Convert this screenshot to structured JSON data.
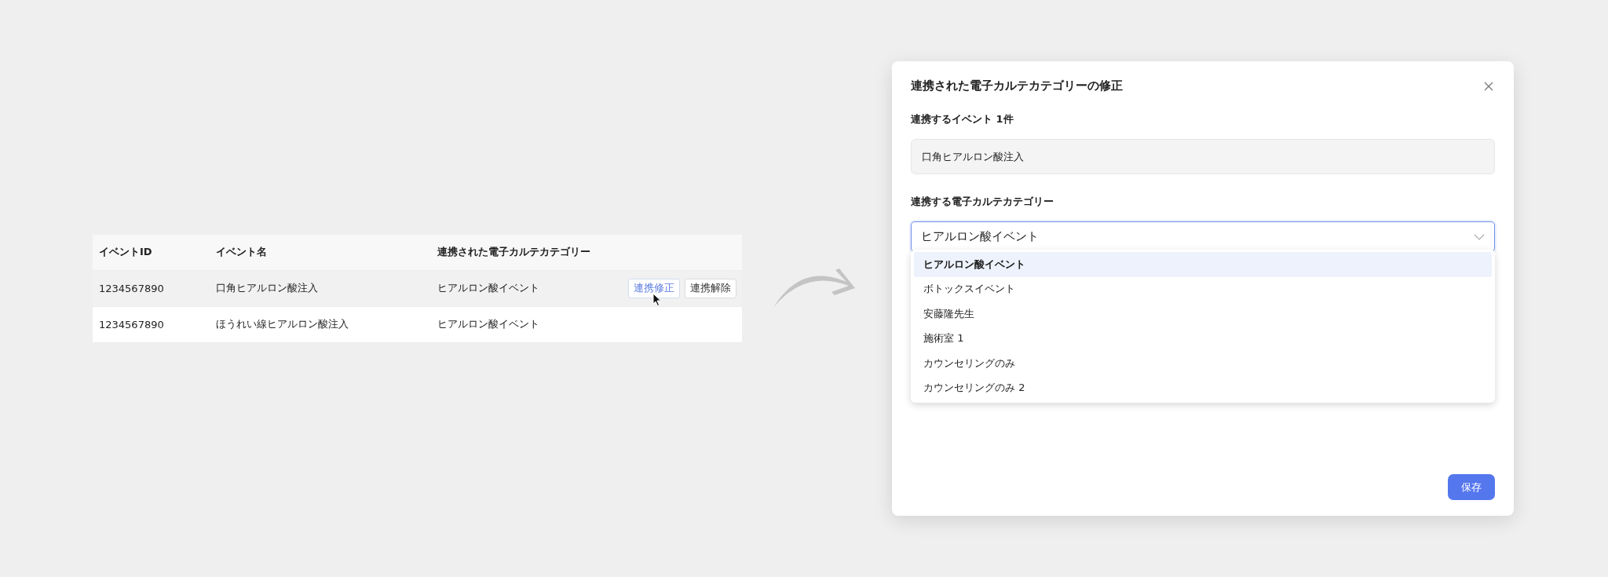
{
  "table": {
    "columns": [
      "イベントID",
      "イベント名",
      "連携された電子カルテカテゴリー"
    ],
    "rows": [
      {
        "id": "1234567890",
        "name": "口角ヒアルロン酸注入",
        "category": "ヒアルロン酸イベント",
        "highlighted": true,
        "actions": [
          {
            "label": "連携修正",
            "hovered": true
          },
          {
            "label": "連携解除",
            "hovered": false
          }
        ]
      },
      {
        "id": "1234567890",
        "name": "ほうれい線ヒアルロン酸注入",
        "category": "ヒアルロン酸イベント",
        "highlighted": false,
        "actions": []
      }
    ]
  },
  "dialog": {
    "title": "連携された電子カルテカテゴリーの修正",
    "event_label": "連携するイベント 1件",
    "event_value": "口角ヒアルロン酸注入",
    "category_label": "連携する電子カルテカテゴリー",
    "category_value": "ヒアルロン酸イベント",
    "expanded": true,
    "options": [
      {
        "label": "ヒアルロン酸イベント",
        "selected": true
      },
      {
        "label": "ボトックスイベント",
        "selected": false
      },
      {
        "label": "安藤隆先生",
        "selected": false
      },
      {
        "label": "施術室 1",
        "selected": false
      },
      {
        "label": "カウンセリングのみ",
        "selected": false
      },
      {
        "label": "カウンセリングのみ 2",
        "selected": false
      }
    ],
    "save_button": "保存"
  }
}
